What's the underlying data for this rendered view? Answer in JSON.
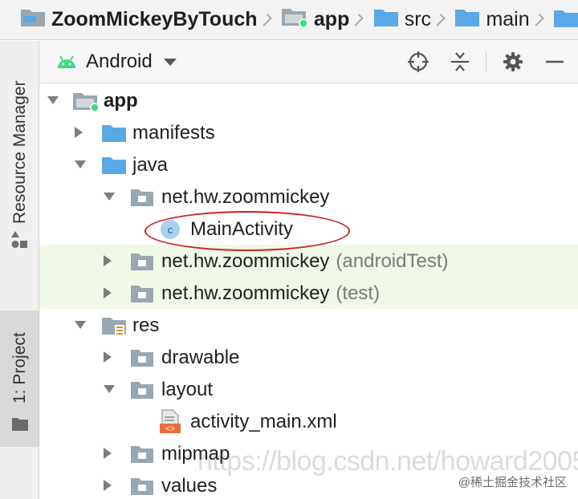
{
  "breadcrumb": [
    {
      "label": "ZoomMickeyByTouch",
      "icon": "project-folder-icon",
      "bold": true
    },
    {
      "label": "app",
      "icon": "module-folder-icon",
      "bold": true
    },
    {
      "label": "src",
      "icon": "folder-icon",
      "bold": false
    },
    {
      "label": "main",
      "icon": "folder-icon",
      "bold": false
    }
  ],
  "left_strip": {
    "resource_manager": "Resource Manager",
    "project": "1: Project"
  },
  "toolbar": {
    "view": "Android"
  },
  "tree": [
    {
      "label": "app",
      "suffix": "",
      "icon": "module-folder-icon",
      "arrow": "down",
      "indent": 0,
      "bold": true,
      "highlight": false
    },
    {
      "label": "manifests",
      "suffix": "",
      "icon": "folder-icon",
      "arrow": "right",
      "indent": 1,
      "bold": false,
      "highlight": false
    },
    {
      "label": "java",
      "suffix": "",
      "icon": "folder-icon",
      "arrow": "down",
      "indent": 1,
      "bold": false,
      "highlight": false
    },
    {
      "label": "net.hw.zoommickey",
      "suffix": "",
      "icon": "package-icon",
      "arrow": "down",
      "indent": 2,
      "bold": false,
      "highlight": false
    },
    {
      "label": "MainActivity",
      "suffix": "",
      "icon": "class-icon",
      "arrow": "",
      "indent": 3,
      "bold": false,
      "highlight": false
    },
    {
      "label": "net.hw.zoommickey",
      "suffix": "(androidTest)",
      "icon": "package-icon",
      "arrow": "right",
      "indent": 2,
      "bold": false,
      "highlight": true
    },
    {
      "label": "net.hw.zoommickey",
      "suffix": "(test)",
      "icon": "package-icon",
      "arrow": "right",
      "indent": 2,
      "bold": false,
      "highlight": true
    },
    {
      "label": "res",
      "suffix": "",
      "icon": "res-folder-icon",
      "arrow": "down",
      "indent": 1,
      "bold": false,
      "highlight": false
    },
    {
      "label": "drawable",
      "suffix": "",
      "icon": "package-icon",
      "arrow": "right",
      "indent": 2,
      "bold": false,
      "highlight": false
    },
    {
      "label": "layout",
      "suffix": "",
      "icon": "package-icon",
      "arrow": "down",
      "indent": 2,
      "bold": false,
      "highlight": false
    },
    {
      "label": "activity_main.xml",
      "suffix": "",
      "icon": "xml-file-icon",
      "arrow": "",
      "indent": 3,
      "bold": false,
      "highlight": false
    },
    {
      "label": "mipmap",
      "suffix": "",
      "icon": "package-icon",
      "arrow": "right",
      "indent": 2,
      "bold": false,
      "highlight": false
    },
    {
      "label": "values",
      "suffix": "",
      "icon": "package-icon",
      "arrow": "right",
      "indent": 2,
      "bold": false,
      "highlight": false
    }
  ],
  "watermark": "https://blog.csdn.net/howard2005",
  "watermark_credit": "@稀土掘金技术社区",
  "colors": {
    "folder_blue": "#5aa9e6",
    "folder_gray": "#9aa7b0",
    "android_green": "#3ddc84",
    "highlight_green": "#f0f8e8",
    "annotation_red": "#cc2222"
  }
}
